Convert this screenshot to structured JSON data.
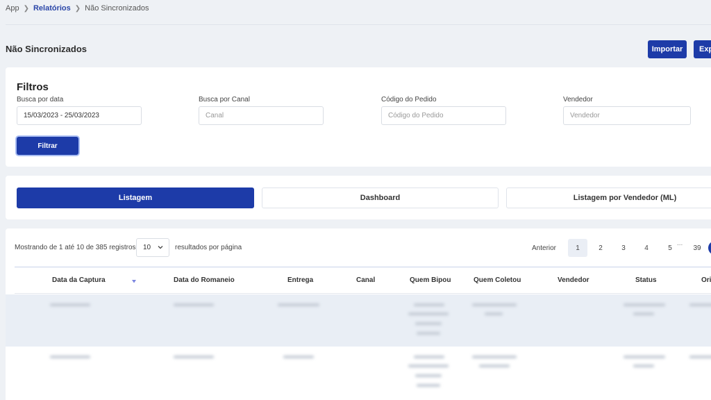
{
  "breadcrumb": {
    "root": "App",
    "section": "Relatórios",
    "current": "Não Sincronizados"
  },
  "header": {
    "title": "Não Sincronizados",
    "import_label": "Importar",
    "export_label": "Exp"
  },
  "filters": {
    "title": "Filtros",
    "date": {
      "label": "Busca por data",
      "value": "15/03/2023 - 25/03/2023"
    },
    "channel": {
      "label": "Busca por Canal",
      "placeholder": "Canal"
    },
    "order_code": {
      "label": "Código do Pedido",
      "placeholder": "Código do Pedido"
    },
    "seller": {
      "label": "Vendedor",
      "placeholder": "Vendedor"
    },
    "filter_button": "Filtrar"
  },
  "tabs": [
    {
      "label": "Listagem",
      "active": true
    },
    {
      "label": "Dashboard",
      "active": false
    },
    {
      "label": "Listagem por Vendedor (ML)",
      "active": false
    }
  ],
  "table": {
    "showing": "Mostrando de 1 até 10 de 385 registros",
    "page_size": "10",
    "per_page_label": "resultados por página",
    "pagination": {
      "prev": "Anterior",
      "pages": [
        "1",
        "2",
        "3",
        "4",
        "5"
      ],
      "ellipsis": "...",
      "last": "39",
      "current": "1"
    },
    "columns": [
      "Data da Captura",
      "Data do Romaneio",
      "Entrega",
      "Canal",
      "Quem Bipou",
      "Quem Coletou",
      "Vendedor",
      "Status",
      "Ori"
    ]
  },
  "colors": {
    "primary": "#1d3ba8",
    "link": "#2a46a8",
    "background": "#eef1f5"
  }
}
